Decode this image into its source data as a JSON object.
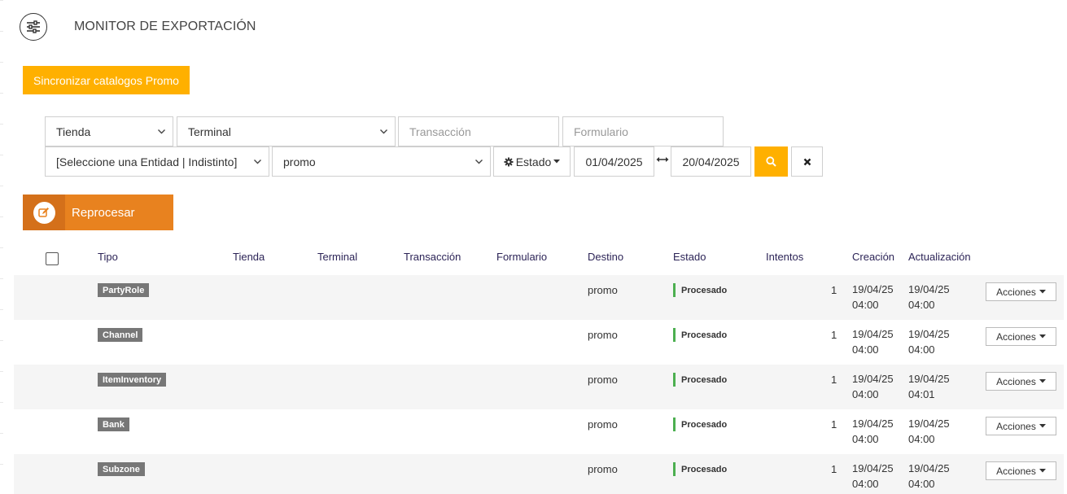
{
  "header": {
    "title": "MONITOR DE EXPORTACIÓN",
    "menu_icon": "sliders-icon"
  },
  "actions": {
    "sync_label": "Sincronizar catalogos Promo",
    "reprocess_label": "Reprocesar",
    "reprocess_icon": "edit-icon"
  },
  "filters": {
    "tienda": "Tienda",
    "terminal": "Terminal",
    "transaccion_placeholder": "Transacción",
    "formulario_placeholder": "Formulario",
    "entidad": "[Seleccione una Entidad | Indistinto]",
    "destino": "promo",
    "estado_label": "Estado",
    "fecha_desde": "01/04/2025",
    "fecha_hasta": "20/04/2025"
  },
  "table": {
    "columns": [
      "Tipo",
      "Tienda",
      "Terminal",
      "Transacción",
      "Formulario",
      "Destino",
      "Estado",
      "Intentos",
      "Creación",
      "Actualización"
    ],
    "rows": [
      {
        "tipo": "PartyRole",
        "destino": "promo",
        "estado": "Procesado",
        "intentos": "1",
        "creacion_fecha": "19/04/25",
        "creacion_hora": "04:00",
        "actualizacion_fecha": "19/04/25",
        "actualizacion_hora": "04:00",
        "acciones": "Acciones"
      },
      {
        "tipo": "Channel",
        "destino": "promo",
        "estado": "Procesado",
        "intentos": "1",
        "creacion_fecha": "19/04/25",
        "creacion_hora": "04:00",
        "actualizacion_fecha": "19/04/25",
        "actualizacion_hora": "04:00",
        "acciones": "Acciones"
      },
      {
        "tipo": "ItemInventory",
        "destino": "promo",
        "estado": "Procesado",
        "intentos": "1",
        "creacion_fecha": "19/04/25",
        "creacion_hora": "04:00",
        "actualizacion_fecha": "19/04/25",
        "actualizacion_hora": "04:01",
        "acciones": "Acciones"
      },
      {
        "tipo": "Bank",
        "destino": "promo",
        "estado": "Procesado",
        "intentos": "1",
        "creacion_fecha": "19/04/25",
        "creacion_hora": "04:00",
        "actualizacion_fecha": "19/04/25",
        "actualizacion_hora": "04:00",
        "acciones": "Acciones"
      },
      {
        "tipo": "Subzone",
        "destino": "promo",
        "estado": "Procesado",
        "intentos": "1",
        "creacion_fecha": "19/04/25",
        "creacion_hora": "04:00",
        "actualizacion_fecha": "19/04/25",
        "actualizacion_hora": "04:00",
        "acciones": "Acciones"
      }
    ]
  },
  "colors": {
    "accent": "#ffb000",
    "reprocess": "#e8821f",
    "status_ok": "#4caf50",
    "header_text": "#2c2457"
  }
}
